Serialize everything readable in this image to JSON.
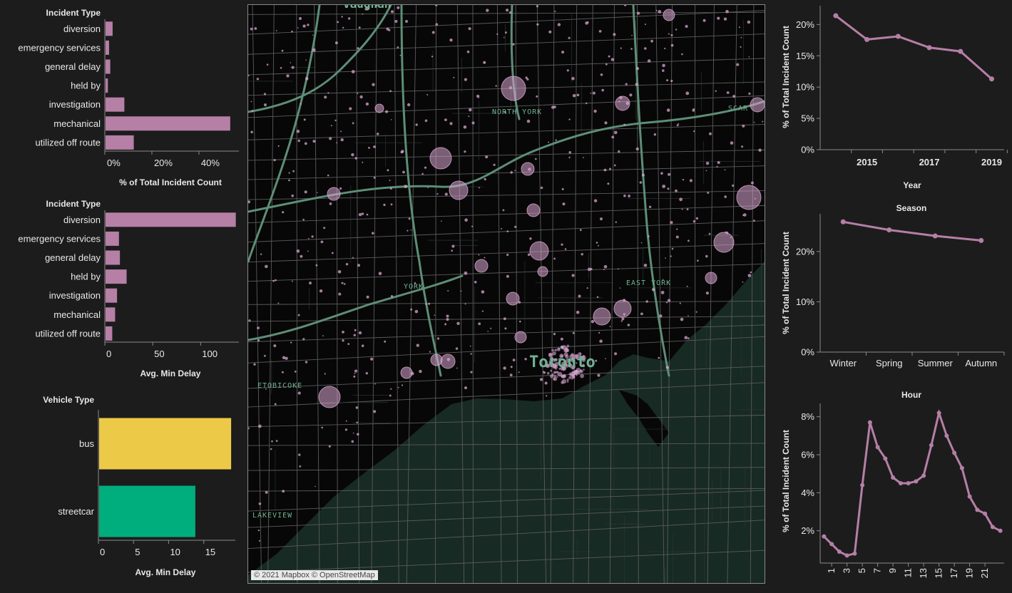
{
  "colors": {
    "background": "#1c1c1c",
    "incident_bar": "#b57fa6",
    "line": "#b57fa6",
    "bus": "#edc948",
    "streetcar": "#00ad7c",
    "map_water": "#172a23",
    "map_roads": "#5d8e77",
    "map_points": "#d9a6d0"
  },
  "map": {
    "labels": {
      "top": "Vaughan",
      "north_york": "NORTH YORK",
      "scarborough": "SCAR",
      "york": "YORK",
      "east_york": "EAST YORK",
      "toronto": "Toronto",
      "etobicoke": "ETOBICOKE",
      "lakeview": "LAKEVIEW"
    },
    "credit": "© 2021 Mapbox © OpenStreetMap"
  },
  "chart_data": [
    {
      "id": "incident_pct_by_type",
      "type": "bar",
      "orientation": "horizontal",
      "category_header": "Incident Type",
      "categories": [
        "diversion",
        "emergency services",
        "general delay",
        "held by",
        "investigation",
        "mechanical",
        "utilized off route"
      ],
      "values": [
        3,
        1.5,
        2,
        1,
        8,
        53,
        12
      ],
      "xlabel": "% of Total Incident Count",
      "ticks": [
        "0%",
        "20%",
        "40%"
      ],
      "tick_values": [
        0,
        20,
        40
      ],
      "xlim": [
        0,
        57
      ]
    },
    {
      "id": "avg_delay_by_type",
      "type": "bar",
      "orientation": "horizontal",
      "category_header": "Incident Type",
      "categories": [
        "diversion",
        "emergency services",
        "general delay",
        "held by",
        "investigation",
        "mechanical",
        "utilized off route"
      ],
      "values": [
        136,
        14,
        15,
        22,
        12,
        10,
        7
      ],
      "xlabel": "Avg. Min Delay",
      "ticks": [
        "0",
        "50",
        "100"
      ],
      "tick_values": [
        0,
        50,
        100
      ],
      "xlim": [
        0,
        140
      ]
    },
    {
      "id": "avg_delay_by_vehicle",
      "type": "bar",
      "orientation": "horizontal",
      "category_header": "Vehicle Type",
      "categories": [
        "bus",
        "streetcar"
      ],
      "values": [
        18.8,
        13.7
      ],
      "xlabel": "Avg. Min Delay",
      "ticks": [
        "0",
        "5",
        "10",
        "15"
      ],
      "tick_values": [
        0,
        5,
        10,
        15
      ],
      "xlim": [
        0,
        19.5
      ]
    },
    {
      "id": "pct_by_year",
      "type": "line",
      "x": [
        2014,
        2015,
        2016,
        2017,
        2018,
        2019
      ],
      "y": [
        21.4,
        17.6,
        18.1,
        16.3,
        15.7,
        11.3
      ],
      "xticks": [
        "2015",
        "2017",
        "2019"
      ],
      "xtick_values": [
        2015,
        2017,
        2019
      ],
      "xlim": [
        2013.5,
        2019.4
      ],
      "ylim": [
        0,
        23
      ],
      "yticks": [
        "0%",
        "5%",
        "10%",
        "15%",
        "20%"
      ],
      "ytick_values": [
        0,
        5,
        10,
        15,
        20
      ],
      "xlabel": "Year",
      "ylabel": "% of Total Incident Count"
    },
    {
      "id": "pct_by_season",
      "type": "line",
      "title": "Season",
      "categories": [
        "Winter",
        "Spring",
        "Summer",
        "Autumn"
      ],
      "values": [
        25.9,
        24.3,
        23.1,
        22.2
      ],
      "ylim": [
        0,
        27.5
      ],
      "yticks": [
        "0%",
        "10%",
        "20%"
      ],
      "ytick_values": [
        0,
        10,
        20
      ],
      "ylabel": "% of Total Incident Count"
    },
    {
      "id": "pct_by_hour",
      "type": "line",
      "title": "Hour",
      "x": [
        0,
        1,
        2,
        3,
        4,
        5,
        6,
        7,
        8,
        9,
        10,
        11,
        12,
        13,
        14,
        15,
        16,
        17,
        18,
        19,
        20,
        21,
        22,
        23
      ],
      "y": [
        1.7,
        1.3,
        0.9,
        0.7,
        0.8,
        4.4,
        7.7,
        6.4,
        5.8,
        4.8,
        4.5,
        4.5,
        4.6,
        4.9,
        6.5,
        8.2,
        7.0,
        6.1,
        5.3,
        3.8,
        3.1,
        2.9,
        2.2,
        2.0
      ],
      "xticks": [
        "1",
        "3",
        "5",
        "7",
        "9",
        "11",
        "13",
        "15",
        "17",
        "19",
        "21"
      ],
      "xtick_values": [
        1,
        3,
        5,
        7,
        9,
        11,
        13,
        15,
        17,
        19,
        21
      ],
      "xlim": [
        -0.5,
        23.5
      ],
      "ylim": [
        0.3,
        8.7
      ],
      "yticks": [
        "2%",
        "4%",
        "6%",
        "8%"
      ],
      "ytick_values": [
        2,
        4,
        6,
        8
      ],
      "ylabel": "% of Total Incident Count"
    }
  ]
}
